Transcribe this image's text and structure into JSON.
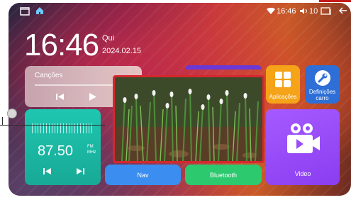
{
  "statusbar": {
    "time": "16:46",
    "volume": "10"
  },
  "clock": {
    "time": "16:46",
    "day": "Qui",
    "date": "2024.02.15"
  },
  "music": {
    "label": "Canções"
  },
  "radio": {
    "frequency": "87.50",
    "band": "FM",
    "unit": "MHz"
  },
  "tiles": {
    "nav": "Nav",
    "bluetooth": "Bluetooth",
    "video": "Video",
    "apps": "Aplicações",
    "settings": "Definições carro"
  },
  "colors": {
    "radio": "#1fc7b0",
    "nav": "#3b8ef0",
    "bluetooth": "#2cc96f",
    "video": "#9a4cf8",
    "apps": "#f5a319",
    "settings": "#2d6fd6",
    "highlight": "#d4282e"
  }
}
